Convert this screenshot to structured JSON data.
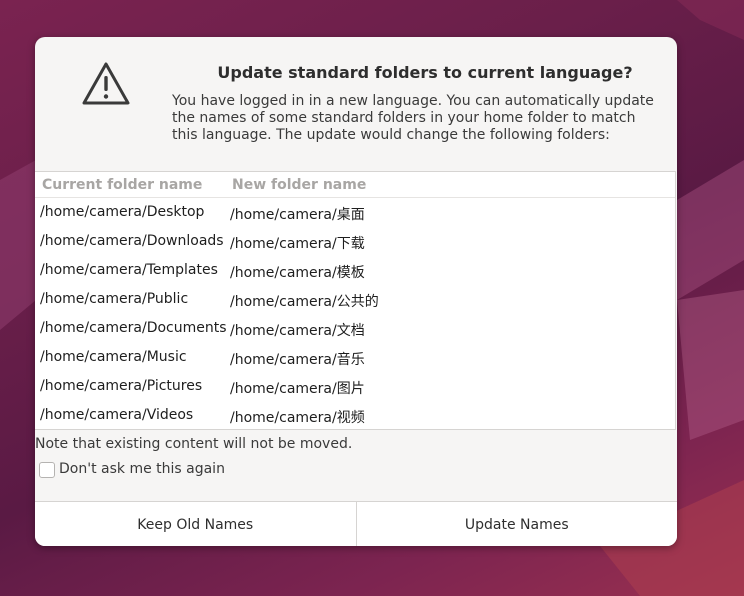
{
  "dialog": {
    "title": "Update standard folders to current language?",
    "message": "You have logged in in a new language. You can automatically update the names of some standard folders in your home folder to match this language. The update would change the following folders:",
    "icon": "warning-icon",
    "columns": {
      "current": "Current folder name",
      "new": "New folder name"
    },
    "folders": [
      {
        "current": "/home/camera/Desktop",
        "new": "/home/camera/桌面"
      },
      {
        "current": "/home/camera/Downloads",
        "new": "/home/camera/下载"
      },
      {
        "current": "/home/camera/Templates",
        "new": "/home/camera/模板"
      },
      {
        "current": "/home/camera/Public",
        "new": "/home/camera/公共的"
      },
      {
        "current": "/home/camera/Documents",
        "new": "/home/camera/文档"
      },
      {
        "current": "/home/camera/Music",
        "new": "/home/camera/音乐"
      },
      {
        "current": "/home/camera/Pictures",
        "new": "/home/camera/图片"
      },
      {
        "current": "/home/camera/Videos",
        "new": "/home/camera/视频"
      }
    ],
    "note": "Note that existing content will not be moved.",
    "dont_ask_label": "Don't ask me this again",
    "dont_ask_checked": false,
    "keep_button": "Keep Old Names",
    "update_button": "Update Names"
  },
  "colors": {
    "background": "#6a1f4a",
    "dialog_bg": "#f6f5f4",
    "list_bg": "#ffffff",
    "header_text": "#a8a6a4"
  }
}
